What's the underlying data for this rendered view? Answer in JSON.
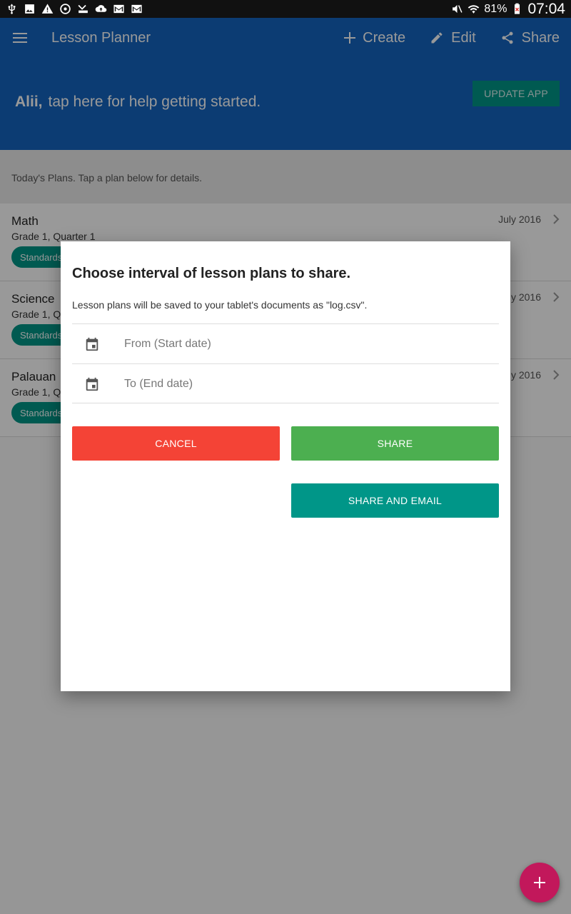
{
  "status_bar": {
    "battery": "81%",
    "time": "07:04"
  },
  "appbar": {
    "title": "Lesson Planner",
    "actions": [
      {
        "label": "Create",
        "icon": "plus-icon"
      },
      {
        "label": "Edit",
        "icon": "pencil-icon"
      },
      {
        "label": "Share",
        "icon": "share-icon"
      }
    ]
  },
  "banner": {
    "user": "Alii,",
    "message": "tap here for help getting started.",
    "update_button": "UPDATE APP"
  },
  "info": {
    "text": "Today's Plans. Tap a plan below for details."
  },
  "plans": [
    {
      "name": "Math",
      "subtitle": "Grade 1, Quarter 1",
      "chip": "Standards",
      "date": "July 2016"
    },
    {
      "name": "Science",
      "subtitle": "Grade 1, Qu",
      "chip": "Standards",
      "date": "y 2016"
    },
    {
      "name": "Palauan",
      "subtitle": "Grade 1, Qu",
      "chip": "Standards",
      "date": "y 2016"
    }
  ],
  "dialog": {
    "title": "Choose interval of lesson plans to share.",
    "description": "Lesson plans will be saved to your tablet's documents as \"log.csv\".",
    "from_placeholder": "From (Start date)",
    "to_placeholder": "To (End date)",
    "cancel_label": "CANCEL",
    "share_label": "SHARE",
    "share_email_label": "SHARE AND EMAIL"
  },
  "colors": {
    "primary": "#1565c0",
    "teal": "#009688",
    "cancel": "#f44336",
    "share": "#4caf50",
    "fab": "#c2185b"
  }
}
